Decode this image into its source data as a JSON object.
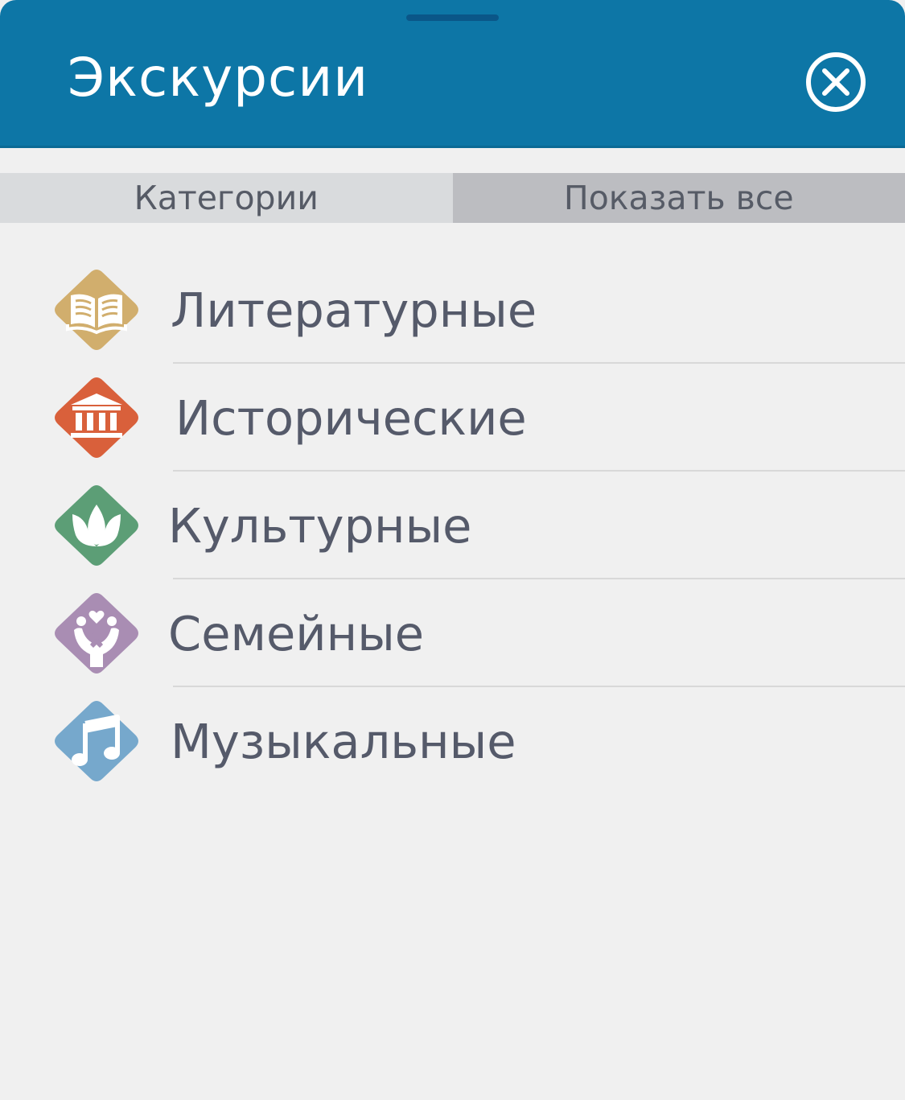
{
  "header": {
    "title": "Экскурсии",
    "close_icon": "close-circle-icon",
    "background_color": "#0d76a6"
  },
  "tabs": [
    {
      "label": "Категории",
      "selected": false
    },
    {
      "label": "Показать все",
      "selected": true
    }
  ],
  "categories": [
    {
      "label": "Литературные",
      "icon": "open-book-icon",
      "color": "#d1ae6d"
    },
    {
      "label": "Исторические",
      "icon": "museum-building-icon",
      "color": "#d9603b"
    },
    {
      "label": "Культурные",
      "icon": "lotus-flower-icon",
      "color": "#5c9e76"
    },
    {
      "label": "Семейные",
      "icon": "family-heart-icon",
      "color": "#a98db3"
    },
    {
      "label": "Музыкальные",
      "icon": "music-note-icon",
      "color": "#76a8cc"
    }
  ]
}
